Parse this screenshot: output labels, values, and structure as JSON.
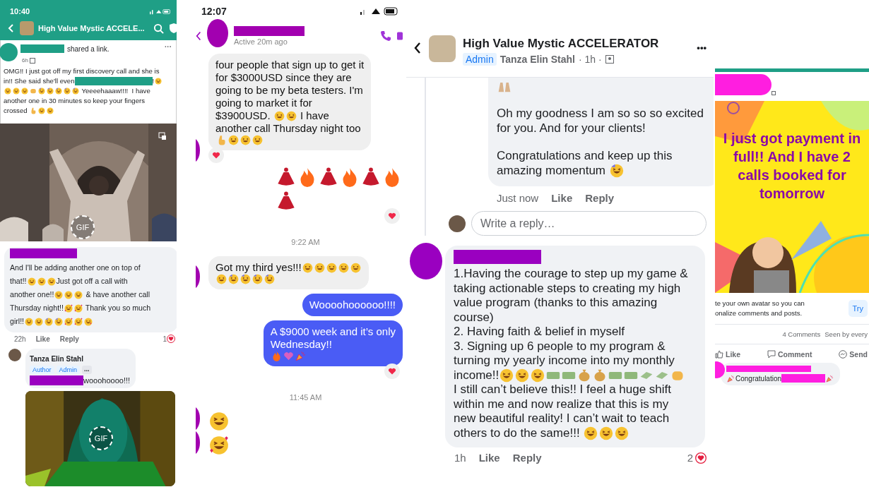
{
  "group_post": {
    "status_bar": {
      "time": "10:40"
    },
    "header": {
      "title": "High Value Mystic ACCELE..."
    },
    "post": {
      "action": "shared a link.",
      "time": "6h",
      "more": "···",
      "lines": [
        [
          {
            "kind": "text",
            "text": "OMG!! I just got off my first discovery call and she is"
          }
        ],
        [
          {
            "kind": "text",
            "text": "in!! She said she'll even"
          },
          {
            "kind": "redacted"
          },
          {
            "kind": "text",
            "text": "!"
          },
          {
            "kind": "emoji",
            "emojis": [
              {
                "kind": "laugh"
              }
            ]
          }
        ],
        [
          {
            "kind": "emoji",
            "emojis": [
              {
                "kind": "laugh"
              },
              {
                "kind": "laugh"
              },
              {
                "kind": "laugh"
              },
              {
                "kind": "fist"
              },
              {
                "kind": "party"
              },
              {
                "kind": "party"
              },
              {
                "kind": "party"
              },
              {
                "kind": "party"
              },
              {
                "kind": "party"
              }
            ]
          },
          {
            "kind": "text",
            "text": " Yeeeehaaaw!!!!  I have"
          }
        ],
        [
          {
            "kind": "text",
            "text": "another one in 30 minutes so keep your fingers"
          }
        ],
        [
          {
            "kind": "text",
            "text": "crossed "
          },
          {
            "kind": "emoji",
            "emojis": [
              {
                "kind": "fingers"
              },
              {
                "kind": "laugh"
              },
              {
                "kind": "laugh"
              }
            ]
          }
        ]
      ],
      "gif_badge": "GIF"
    },
    "comment": {
      "lines": [
        [
          {
            "kind": "text",
            "text": "And I'll be adding another one on top of"
          }
        ],
        [
          {
            "kind": "text",
            "text": "that!!"
          },
          {
            "kind": "emoji",
            "emojis": [
              {
                "kind": "laugh"
              },
              {
                "kind": "laugh"
              },
              {
                "kind": "laugh"
              }
            ]
          },
          {
            "kind": "text",
            "text": "Just got off a call with"
          }
        ],
        [
          {
            "kind": "text",
            "text": "another one!!"
          },
          {
            "kind": "emoji",
            "emojis": [
              {
                "kind": "laugh"
              },
              {
                "kind": "laugh"
              },
              {
                "kind": "laugh"
              }
            ]
          },
          {
            "kind": "text",
            "text": " & have another call"
          }
        ],
        [
          {
            "kind": "text",
            "text": "Thursday night!!"
          },
          {
            "kind": "emoji",
            "emojis": [
              {
                "kind": "hearts"
              },
              {
                "kind": "hearts"
              }
            ]
          },
          {
            "kind": "text",
            "text": " Thank you so much"
          }
        ],
        [
          {
            "kind": "text",
            "text": "girl!!"
          },
          {
            "kind": "emoji",
            "emojis": [
              {
                "kind": "laugh"
              },
              {
                "kind": "laugh"
              },
              {
                "kind": "party"
              },
              {
                "kind": "party"
              },
              {
                "kind": "hearts"
              },
              {
                "kind": "hearts"
              },
              {
                "kind": "kiss"
              }
            ]
          }
        ]
      ],
      "time": "22h",
      "like": "Like",
      "reply": "Reply",
      "reaction_count": "1"
    },
    "reply": {
      "author": "Tanza Elin Stahl",
      "badges": [
        "Author",
        "Admin"
      ],
      "more": "...",
      "text": "wooohoooo!!!",
      "gif_badge": "GIF"
    }
  },
  "messenger": {
    "status_bar": {
      "time": "12:07"
    },
    "header": {
      "status": "Active 20m ago"
    },
    "messages": [
      {
        "kind": "received",
        "reacted": true,
        "lines": [
          [
            {
              "kind": "text",
              "text": "four people that sign up to get it"
            }
          ],
          [
            {
              "kind": "text",
              "text": "for $3000USD since they are"
            }
          ],
          [
            {
              "kind": "text",
              "text": "going to be my beta testers. I'm"
            }
          ],
          [
            {
              "kind": "text",
              "text": "going to market it for"
            }
          ],
          [
            {
              "kind": "text",
              "text": "$3900USD. "
            },
            {
              "kind": "emoji",
              "emojis": [
                {
                  "kind": "laugh"
                },
                {
                  "kind": "laugh"
                }
              ]
            },
            {
              "kind": "text",
              "text": " I have"
            }
          ],
          [
            {
              "kind": "text",
              "text": "another call Thursday night too"
            }
          ],
          [
            {
              "kind": "emoji",
              "emojis": [
                {
                  "kind": "fingers"
                },
                {
                  "kind": "laugh"
                },
                {
                  "kind": "laugh"
                },
                {
                  "kind": "laugh"
                }
              ]
            }
          ]
        ]
      },
      {
        "kind": "sent_emoji",
        "reacted": true,
        "lines": [
          [
            {
              "kind": "emoji",
              "emojis": [
                {
                  "kind": "dancer"
                },
                {
                  "kind": "fire"
                },
                {
                  "kind": "dancer"
                },
                {
                  "kind": "fire"
                },
                {
                  "kind": "dancer"
                },
                {
                  "kind": "fire"
                }
              ]
            }
          ],
          [
            {
              "kind": "emoji",
              "emojis": [
                {
                  "kind": "dancer"
                }
              ]
            }
          ]
        ]
      },
      {
        "kind": "timestamp",
        "text": "9:22 AM"
      },
      {
        "kind": "received",
        "reacted": false,
        "lines": [
          [
            {
              "kind": "text",
              "text": "Got my third yes!!!"
            },
            {
              "kind": "emoji",
              "emojis": [
                {
                  "kind": "laugh"
                },
                {
                  "kind": "laugh"
                },
                {
                  "kind": "laugh"
                },
                {
                  "kind": "laugh"
                },
                {
                  "kind": "laugh"
                }
              ]
            }
          ],
          [
            {
              "kind": "emoji",
              "emojis": [
                {
                  "kind": "laugh"
                },
                {
                  "kind": "party"
                },
                {
                  "kind": "party"
                },
                {
                  "kind": "party"
                },
                {
                  "kind": "party"
                }
              ]
            }
          ]
        ]
      },
      {
        "kind": "sent",
        "reacted": false,
        "lines": [
          [
            {
              "kind": "text",
              "text": "Woooohoooooo!!!!"
            }
          ]
        ]
      },
      {
        "kind": "sent",
        "reacted": true,
        "lines": [
          [
            {
              "kind": "text",
              "text": "A $9000 week and it’s only"
            }
          ],
          [
            {
              "kind": "text",
              "text": "Wednesday!!"
            }
          ],
          [
            {
              "kind": "emoji",
              "emojis": [
                {
                  "kind": "fire"
                },
                {
                  "kind": "sparkle_heart"
                },
                {
                  "kind": "popper"
                }
              ]
            }
          ]
        ]
      },
      {
        "kind": "timestamp",
        "text": "11:45 AM"
      },
      {
        "kind": "received_emoji",
        "reacted": false,
        "lines": [
          [
            {
              "kind": "emoji",
              "emojis": [
                {
                  "kind": "laugh"
                }
              ]
            }
          ]
        ]
      },
      {
        "kind": "received_emoji",
        "reacted": false,
        "lines": [
          [
            {
              "kind": "emoji",
              "emojis": [
                {
                  "kind": "hearts"
                }
              ]
            }
          ]
        ]
      }
    ]
  },
  "group_comments": {
    "header": {
      "title": "High Value Mystic ACCELERATOR",
      "badge": "Admin",
      "author": "Tanza Elin Stahl",
      "time": "· 1h ·",
      "more": "•••"
    },
    "comment": {
      "paragraphs": [
        [
          [
            {
              "kind": "emoji",
              "emojis": [
                {
                  "kind": "hands"
                }
              ]
            }
          ]
        ],
        [
          [
            {
              "kind": "text",
              "text": "Oh my goodness I am so so so excited"
            }
          ],
          [
            {
              "kind": "text",
              "text": "for you. And for your clients!"
            }
          ]
        ],
        [
          [
            {
              "kind": "text",
              "text": "Congratulations and keep up this"
            }
          ],
          [
            {
              "kind": "text",
              "text": "amazing momentum "
            },
            {
              "kind": "emoji",
              "emojis": [
                {
                  "kind": "party"
                }
              ]
            }
          ]
        ]
      ],
      "time": "Just now",
      "like": "Like",
      "reply": "Reply"
    },
    "reply_field": {
      "placeholder": "Write a reply…"
    },
    "comment_2": {
      "lines": [
        [
          {
            "kind": "text",
            "text": "1.Having the courage to step up my game &"
          }
        ],
        [
          {
            "kind": "text",
            "text": "taking actionable steps to creating my high"
          }
        ],
        [
          {
            "kind": "text",
            "text": "value program (thanks to this amazing"
          }
        ],
        [
          {
            "kind": "text",
            "text": "course)"
          }
        ],
        [
          {
            "kind": "text",
            "text": "2. Having faith & belief in myself"
          }
        ],
        [
          {
            "kind": "text",
            "text": "3. Signing up 6 people to my program &"
          }
        ],
        [
          {
            "kind": "text",
            "text": "turning my yearly income into my monthly"
          }
        ],
        [
          {
            "kind": "text",
            "text": "income!!"
          },
          {
            "kind": "emoji",
            "emojis": [
              {
                "kind": "laugh"
              },
              {
                "kind": "laugh"
              },
              {
                "kind": "laugh"
              },
              {
                "kind": "money"
              },
              {
                "kind": "money"
              },
              {
                "kind": "moneybag"
              },
              {
                "kind": "moneybag"
              },
              {
                "kind": "money"
              },
              {
                "kind": "money"
              },
              {
                "kind": "money_wings"
              },
              {
                "kind": "money_wings"
              },
              {
                "kind": "fist"
              }
            ]
          }
        ],
        [
          {
            "kind": "text",
            "text": "I still can’t believe this!! I feel a huge shift"
          }
        ],
        [
          {
            "kind": "text",
            "text": "within me and now realize that this is my"
          }
        ],
        [
          {
            "kind": "text",
            "text": "new beautiful reality! I can’t wait to teach"
          }
        ],
        [
          {
            "kind": "text",
            "text": "others to do the same!!! "
          },
          {
            "kind": "emoji",
            "emojis": [
              {
                "kind": "laugh"
              },
              {
                "kind": "laugh"
              },
              {
                "kind": "laugh"
              }
            ]
          }
        ]
      ],
      "time": "1h",
      "like": "Like",
      "reply": "Reply",
      "reaction_count": "2"
    }
  },
  "group_post_2": {
    "post_text": "I just got payment in full!! And I have 2 calls booked for tomorrow",
    "avatar_prompt": {
      "text": "te your own avatar so you can\nonalize comments and posts.",
      "button": "Try"
    },
    "stats": {
      "comments": "4 Comments",
      "seen": "Seen by every"
    },
    "actions": [
      {
        "kind": "like",
        "label": "Like"
      },
      {
        "kind": "comment",
        "label": "Comment"
      },
      {
        "kind": "send",
        "label": "Send"
      }
    ],
    "comment": {
      "lines": [
        [
          {
            "kind": "emoji",
            "emojis": [
              {
                "kind": "popper"
              }
            ]
          },
          {
            "kind": "text",
            "text": "Congratulation"
          },
          {
            "kind": "redacted"
          },
          {
            "kind": "emoji",
            "emojis": [
              {
                "kind": "popper"
              }
            ]
          }
        ]
      ]
    }
  }
}
